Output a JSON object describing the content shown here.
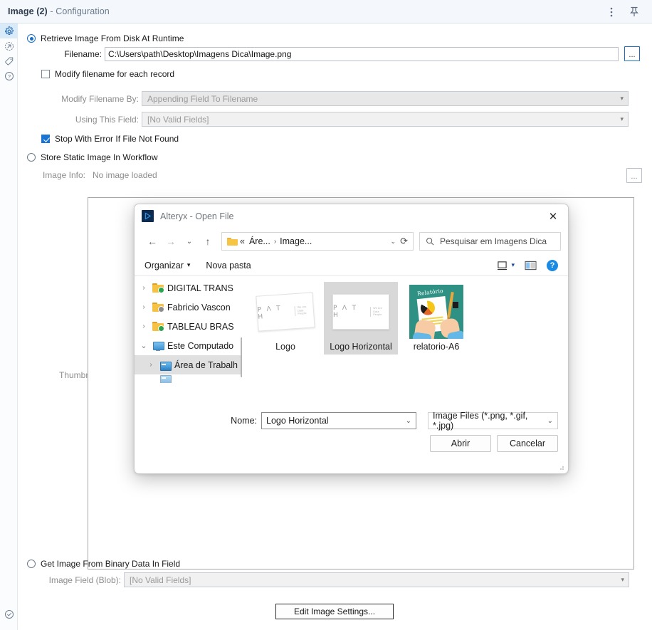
{
  "window": {
    "title_bold": "Image (2)",
    "title_sep": "-",
    "title_sub": "Configuration",
    "menu_icon": "kebab-menu-icon",
    "pin_icon": "pin-icon"
  },
  "rail": {
    "items": [
      {
        "name": "configuration-gear",
        "glyph": "⚙",
        "active": true
      },
      {
        "name": "output-arrow",
        "glyph": "↗",
        "active": false
      },
      {
        "name": "annotation-tag",
        "glyph": "◇",
        "active": false
      },
      {
        "name": "help-question",
        "glyph": "?",
        "active": false
      }
    ],
    "status_glyph": "✓"
  },
  "config": {
    "option_disk_label": "Retrieve Image From Disk At Runtime",
    "filename_label": "Filename:",
    "filename_value": "C:\\Users\\path\\Desktop\\Imagens Dica\\Image.png",
    "browse_label": "...",
    "modify_filename_label": "Modify filename for each record",
    "modify_by_label": "Modify Filename By:",
    "modify_by_value": "Appending Field To Filename",
    "using_field_label": "Using This Field:",
    "using_field_value": "[No Valid Fields]",
    "stop_error_label": "Stop With Error If File Not Found",
    "option_static_label": "Store Static Image In Workflow",
    "image_info_label": "Image Info:",
    "image_info_value": "No image loaded",
    "thumbnail_label": "Thumbnail:",
    "static_browse_label": "...",
    "option_blob_label": "Get Image From Binary Data In Field",
    "image_field_label": "Image Field (Blob):",
    "image_field_value": "[No Valid Fields]",
    "edit_settings_label": "Edit Image Settings..."
  },
  "dialog": {
    "title": "Alteryx - Open File",
    "close_label": "✕",
    "nav": {
      "back": "←",
      "forward": "→",
      "recent": "⌄",
      "up": "↑",
      "refresh": "⟳"
    },
    "breadcrumb": {
      "prefix": "«",
      "part1": "Áre...",
      "sep": "›",
      "part2": "Image...",
      "caret": "⌄"
    },
    "search_placeholder": "Pesquisar em Imagens Dica",
    "toolbar": {
      "organize": "Organizar",
      "organize_caret": "▾",
      "new_folder": "Nova pasta",
      "view_caret": "▾",
      "help": "?"
    },
    "tree": [
      {
        "label": "DIGITAL TRANS",
        "icon": "folder-sync-icon",
        "expander": "›",
        "selected": false,
        "indent": false,
        "badge": "green"
      },
      {
        "label": "Fabricio Vascon",
        "icon": "folder-sync-icon",
        "expander": "›",
        "selected": false,
        "indent": false,
        "badge": "grey"
      },
      {
        "label": "TABLEAU BRAS",
        "icon": "folder-sync-icon",
        "expander": "›",
        "selected": false,
        "indent": false,
        "badge": "green"
      },
      {
        "label": "Este Computado",
        "icon": "this-pc-icon",
        "expander": "⌄",
        "selected": false,
        "indent": false,
        "badge": ""
      },
      {
        "label": "Área de Trabalh",
        "icon": "desktop-icon",
        "expander": "›",
        "selected": true,
        "indent": true,
        "badge": ""
      }
    ],
    "files": [
      {
        "name": "Logo",
        "kind": "path-logo-tilted",
        "selected": false
      },
      {
        "name": "Logo Horizontal",
        "kind": "path-logo",
        "selected": true
      },
      {
        "name": "relatorio-A6",
        "kind": "relatorio-illustration",
        "selected": false
      }
    ],
    "logo_text": {
      "word": "P Λ T H",
      "tag_line1": "We Are",
      "tag_line2": "Data People"
    },
    "relatorio_title": "Relatório",
    "footer": {
      "name_label": "Nome:",
      "name_value": "Logo Horizontal",
      "name_caret": "⌄",
      "filter_value": "Image Files (*.png, *.gif, *.jpg)",
      "filter_caret": "⌄",
      "open_label": "Abrir",
      "cancel_label": "Cancelar"
    }
  }
}
